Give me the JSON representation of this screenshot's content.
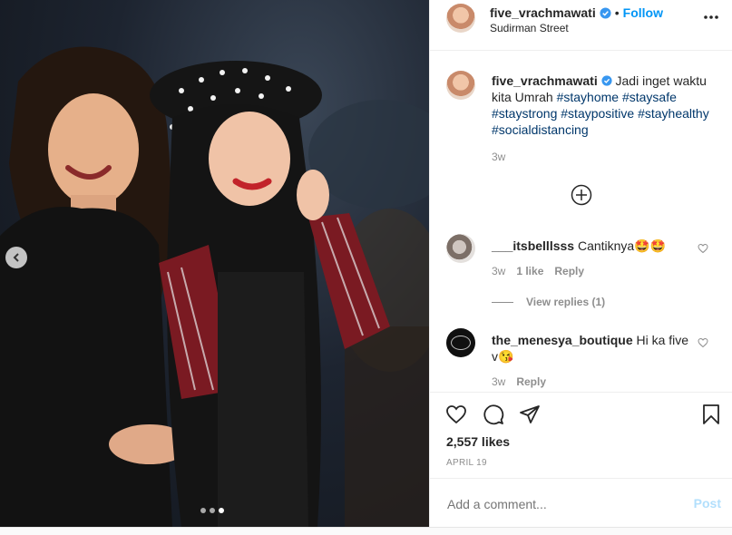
{
  "post": {
    "author": "five_vrachmawati",
    "follow_label": "Follow",
    "location": "Sudirman Street",
    "caption_text": "Jadi inget waktu kita Umrah",
    "hashtags": [
      "#stayhome",
      "#staysafe",
      "#staystrong",
      "#staypositive",
      "#stayhealthy",
      "#socialdistancing"
    ],
    "caption_time": "3w",
    "likes": "2,557 likes",
    "date": "APRIL 19"
  },
  "comments": [
    {
      "user": "___itsbelllsss",
      "text": "Cantiknya🤩🤩",
      "time": "3w",
      "likes": "1 like",
      "reply": "Reply",
      "view_replies": "View replies (1)"
    },
    {
      "user": "the_menesya_boutique",
      "text": "Hi ka five v😘",
      "time": "3w",
      "reply": "Reply"
    }
  ],
  "composer": {
    "placeholder": "Add a comment...",
    "post_label": "Post"
  },
  "carousel": {
    "count": 3,
    "active_index": 2
  },
  "icons": [
    "verified-badge-icon",
    "more-options-icon",
    "load-more-comments-icon",
    "heart-icon",
    "comment-icon",
    "share-icon",
    "bookmark-icon",
    "carousel-prev-icon"
  ],
  "colors": {
    "link_blue": "#0095f6",
    "hashtag": "#00376b",
    "muted": "#8e8e8e",
    "verified": "#3897f0"
  }
}
